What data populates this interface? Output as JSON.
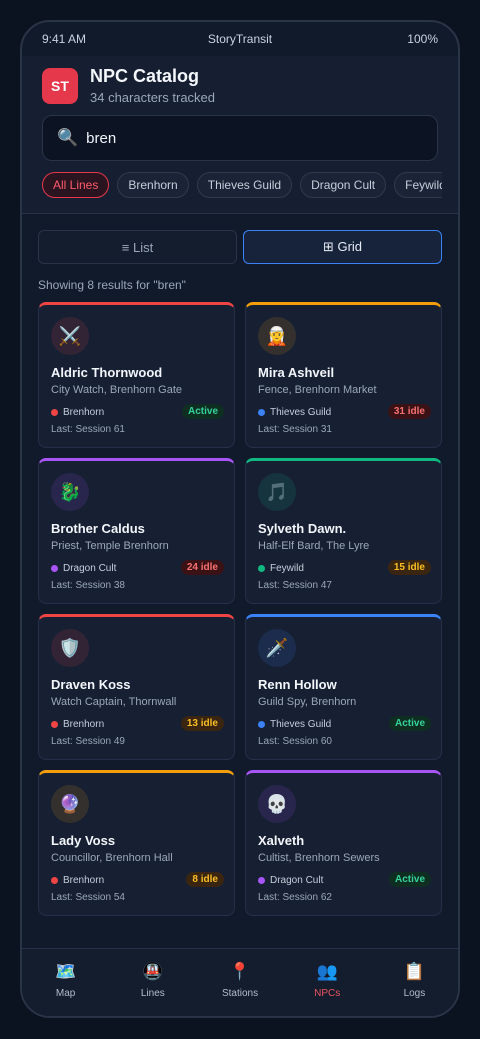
{
  "status_bar": {
    "time": "9:41 AM",
    "carrier": "StoryTransit",
    "battery": "100%"
  },
  "app": {
    "logo": "ST",
    "title": "NPC Catalog",
    "subtitle": "34 characters tracked",
    "brand_color": "#e5384b"
  },
  "search": {
    "value": "bren",
    "placeholder": "Search characters",
    "icon": "magnifier-icon"
  },
  "filters": [
    "All Lines",
    "Brenhorn",
    "Thieves Guild",
    "Dragon Cult",
    "Feywild"
  ],
  "view_toggle": {
    "list_label": "≡ List",
    "grid_label": "⊞ Grid",
    "selected": "grid"
  },
  "results_text": "Showing 8 results for \"bren\"",
  "npcs": [
    {
      "icon": "⚔️",
      "icon_name": "crossed-swords-icon",
      "name": "Aldric Thornwood",
      "role": "City Watch, Brenhorn Gate",
      "line": "Brenhorn",
      "status": "Active",
      "last": "Last: Session 61",
      "accent": "#ef4444",
      "badge_style": "active"
    },
    {
      "icon": "🧝",
      "icon_name": "elf-icon",
      "name": "Mira Ashveil",
      "role": "Fence, Brenhorn Market",
      "line": "Thieves Guild",
      "status": "31 idle",
      "last": "Last: Session 31",
      "accent": "#f59e0b",
      "badge_style": "idle-red"
    },
    {
      "icon": "🐉",
      "icon_name": "dragon-icon",
      "name": "Brother Caldus",
      "role": "Priest, Temple Brenhorn",
      "line": "Dragon Cult",
      "status": "24 idle",
      "last": "Last: Session 38",
      "accent": "#a855f7",
      "badge_style": "idle-red"
    },
    {
      "icon": "🎵",
      "icon_name": "music-note-icon",
      "name": "Sylveth Dawn.",
      "role": "Half-Elf Bard, The Lyre",
      "line": "Feywild",
      "status": "15 idle",
      "last": "Last: Session 47",
      "accent": "#10b981",
      "badge_style": "idle-amber"
    },
    {
      "icon": "🛡️",
      "icon_name": "shield-icon",
      "name": "Draven Koss",
      "role": "Watch Captain, Thornwall",
      "line": "Brenhorn",
      "status": "13 idle",
      "last": "Last: Session 49",
      "accent": "#ef4444",
      "badge_style": "idle-amber"
    },
    {
      "icon": "🗡️",
      "icon_name": "dagger-icon",
      "name": "Renn Hollow",
      "role": "Guild Spy, Brenhorn",
      "line": "Thieves Guild",
      "status": "Active",
      "last": "Last: Session 60",
      "accent": "#3b82f6",
      "badge_style": "active"
    },
    {
      "icon": "🔮",
      "icon_name": "crystal-ball-icon",
      "name": "Lady Voss",
      "role": "Councillor, Brenhorn Hall",
      "line": "Brenhorn",
      "status": "8 idle",
      "last": "Last: Session 54",
      "accent": "#f59e0b",
      "badge_style": "idle-amber"
    },
    {
      "icon": "💀",
      "icon_name": "skull-icon",
      "name": "Xalveth",
      "role": "Cultist, Brenhorn Sewers",
      "line": "Dragon Cult",
      "status": "Active",
      "last": "Last: Session 62",
      "accent": "#a855f7",
      "badge_style": "active"
    }
  ],
  "line_colors": {
    "Brenhorn": "#ef4444",
    "Thieves Guild": "#3b82f6",
    "Dragon Cult": "#a855f7",
    "Feywild": "#10b981"
  },
  "nav": [
    {
      "icon": "🗺️",
      "icon_name": "map-icon",
      "label": "Map"
    },
    {
      "icon": "🚇",
      "icon_name": "metro-icon",
      "label": "Lines"
    },
    {
      "icon": "📍",
      "icon_name": "pin-icon",
      "label": "Stations"
    },
    {
      "icon": "👥",
      "icon_name": "people-icon",
      "label": "NPCs",
      "active": true
    },
    {
      "icon": "📋",
      "icon_name": "clipboard-icon",
      "label": "Logs"
    }
  ]
}
